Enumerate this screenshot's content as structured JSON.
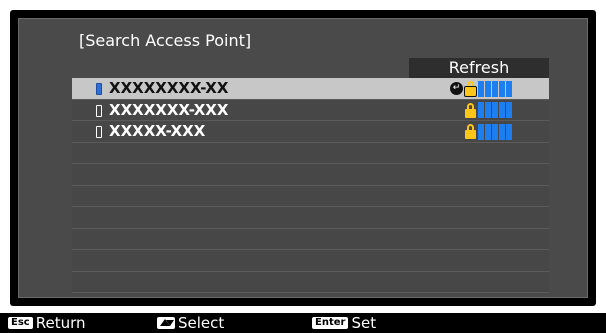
{
  "dialog": {
    "title": "[Search Access Point]",
    "refresh_label": "Refresh"
  },
  "access_points": [
    {
      "name": "XXXXXXXX-XX",
      "selected": true,
      "connected": true,
      "secured": true,
      "signal_bars": 5
    },
    {
      "name": "XXXXXXX-XXX",
      "selected": false,
      "connected": false,
      "secured": true,
      "signal_bars": 5
    },
    {
      "name": "XXXXX-XXX",
      "selected": false,
      "connected": false,
      "secured": true,
      "signal_bars": 5
    }
  ],
  "empty_rows": 7,
  "footer": {
    "return_key": "Esc",
    "return_label": "Return",
    "select_key_icon": "up-down-arrow-icon",
    "select_label": "Select",
    "set_key": "Enter",
    "set_label": "Set"
  },
  "colors": {
    "panel_bg": "#4a4a4a",
    "selected_row_bg": "#c7c7c7",
    "lock": "#ffc61a",
    "signal": "#1d7ef0"
  }
}
